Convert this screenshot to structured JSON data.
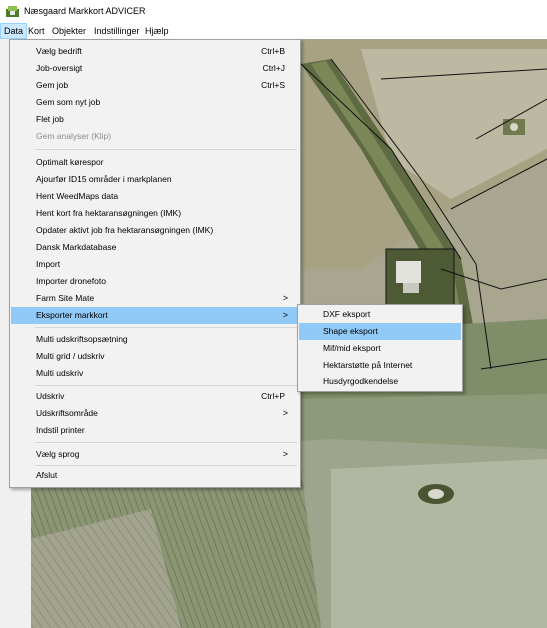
{
  "window": {
    "title": "Næsgaard Markkort ADVICER"
  },
  "menubar": {
    "items": [
      {
        "label": "Data"
      },
      {
        "label": "Kort"
      },
      {
        "label": "Objekter"
      },
      {
        "label": "Indstillinger"
      },
      {
        "label": "Hjælp"
      }
    ]
  },
  "data_menu": {
    "items": [
      {
        "label": "Vælg bedrift",
        "shortcut": "Ctrl+B"
      },
      {
        "label": "Job-oversigt",
        "shortcut": "Ctrl+J"
      },
      {
        "label": "Gem job",
        "shortcut": "Ctrl+S"
      },
      {
        "label": "Gem som nyt job",
        "shortcut": ""
      },
      {
        "label": "Flet job",
        "shortcut": ""
      },
      {
        "label": "Gem analyser (Klip)",
        "shortcut": ""
      },
      {
        "label": "Optimalt kørespor",
        "shortcut": ""
      },
      {
        "label": "Ajourfør ID15 områder i markplanen",
        "shortcut": ""
      },
      {
        "label": "Hent WeedMaps data",
        "shortcut": ""
      },
      {
        "label": "Hent kort fra hektaransøgningen (IMK)",
        "shortcut": ""
      },
      {
        "label": "Opdater aktivt job fra hektaransøgningen (IMK)",
        "shortcut": ""
      },
      {
        "label": "Dansk Markdatabase",
        "shortcut": ""
      },
      {
        "label": "Import",
        "shortcut": ""
      },
      {
        "label": "Importer dronefoto",
        "shortcut": ""
      },
      {
        "label": "Farm Site Mate",
        "shortcut": ">"
      },
      {
        "label": "Eksporter markkort",
        "shortcut": ">"
      },
      {
        "label": "Multi udskriftsopsætning",
        "shortcut": ""
      },
      {
        "label": "Multi grid / udskriv",
        "shortcut": ""
      },
      {
        "label": "Multi udskriv",
        "shortcut": ""
      },
      {
        "label": "Udskriv",
        "shortcut": "Ctrl+P"
      },
      {
        "label": "Udskriftsområde",
        "shortcut": ">"
      },
      {
        "label": "Indstil printer",
        "shortcut": ""
      },
      {
        "label": "Vælg sprog",
        "shortcut": ">"
      },
      {
        "label": "Afslut",
        "shortcut": ""
      }
    ]
  },
  "submenu": {
    "items": [
      {
        "label": "DXF eksport"
      },
      {
        "label": "Shape eksport"
      },
      {
        "label": "Mif/mid eksport"
      },
      {
        "label": "Hektarstøtte på Internet"
      },
      {
        "label": "Husdyrgodkendelse"
      }
    ]
  },
  "colors": {
    "highlight": "#91c9f7",
    "menu_bg": "#f2f2f2",
    "disabled": "#8c8c8c"
  }
}
